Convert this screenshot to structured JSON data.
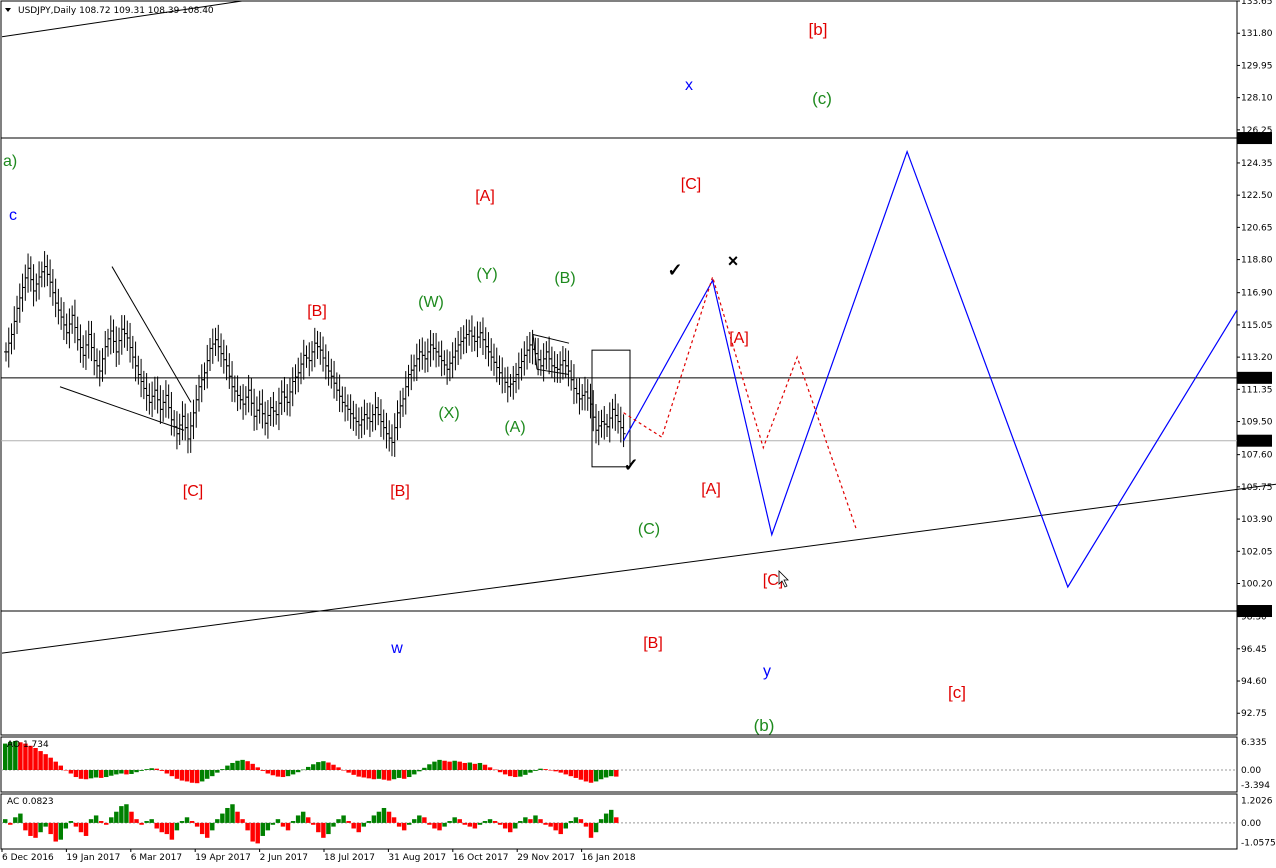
{
  "header": {
    "symbol": "USDJPY,Daily",
    "ohlc": "108.72 109.31 108.39 108.40"
  },
  "colors": {
    "red": "#e00000",
    "green": "#1e8a1e",
    "blue": "#0000ff",
    "black": "#000000",
    "osc_green": "#008000",
    "osc_red": "#ff0000"
  },
  "chart_data": {
    "type": "line",
    "title": "",
    "ylim": [
      91.5,
      133.65
    ],
    "y_ticks": [
      "133.65",
      "131.80",
      "129.95",
      "128.10",
      "126.25",
      "124.35",
      "122.50",
      "120.65",
      "118.80",
      "116.90",
      "115.05",
      "113.20",
      "111.35",
      "109.50",
      "107.60",
      "105.75",
      "103.90",
      "102.05",
      "100.20",
      "98.30",
      "96.45",
      "94.60",
      "92.75"
    ],
    "price_tags": [
      {
        "value": 125.78,
        "label": "125.78",
        "line": true
      },
      {
        "value": 112.01,
        "label": "112.01",
        "line": true
      },
      {
        "value": 108.4,
        "label": "108.40",
        "line": true
      },
      {
        "value": 98.62,
        "label": "98.62",
        "line": true
      }
    ],
    "x_labels": [
      "6 Dec 2016",
      "19 Jan 2017",
      "6 Mar 2017",
      "19 Apr 2017",
      "2 Jun 2017",
      "18 Jul 2017",
      "31 Aug 2017",
      "16 Oct 2017",
      "29 Nov 2017",
      "16 Jan 2018"
    ],
    "price_series": [
      [
        0,
        113.5
      ],
      [
        2,
        114.5
      ],
      [
        4,
        116.0
      ],
      [
        6,
        117.2
      ],
      [
        8,
        118.3
      ],
      [
        10,
        117.0
      ],
      [
        12,
        117.8
      ],
      [
        14,
        118.4
      ],
      [
        16,
        117.5
      ],
      [
        18,
        116.3
      ],
      [
        20,
        115.5
      ],
      [
        22,
        114.6
      ],
      [
        24,
        115.6
      ],
      [
        26,
        114.2
      ],
      [
        28,
        113.3
      ],
      [
        30,
        114.5
      ],
      [
        32,
        113.0
      ],
      [
        34,
        112.4
      ],
      [
        36,
        113.8
      ],
      [
        38,
        114.7
      ],
      [
        40,
        113.5
      ],
      [
        42,
        114.8
      ],
      [
        44,
        114.3
      ],
      [
        46,
        113.2
      ],
      [
        48,
        112.2
      ],
      [
        50,
        111.4
      ],
      [
        52,
        110.6
      ],
      [
        54,
        111.3
      ],
      [
        56,
        110.2
      ],
      [
        58,
        111.0
      ],
      [
        60,
        109.6
      ],
      [
        62,
        108.8
      ],
      [
        64,
        109.8
      ],
      [
        66,
        108.5
      ],
      [
        68,
        110.0
      ],
      [
        70,
        111.5
      ],
      [
        72,
        112.3
      ],
      [
        74,
        113.7
      ],
      [
        76,
        114.2
      ],
      [
        78,
        113.4
      ],
      [
        80,
        112.7
      ],
      [
        82,
        111.5
      ],
      [
        84,
        111.0
      ],
      [
        86,
        110.5
      ],
      [
        88,
        111.3
      ],
      [
        90,
        109.8
      ],
      [
        92,
        110.5
      ],
      [
        94,
        109.4
      ],
      [
        96,
        110.3
      ],
      [
        98,
        109.9
      ],
      [
        100,
        111.2
      ],
      [
        102,
        110.6
      ],
      [
        104,
        111.8
      ],
      [
        106,
        112.3
      ],
      [
        108,
        113.3
      ],
      [
        110,
        113.0
      ],
      [
        112,
        114.0
      ],
      [
        114,
        113.6
      ],
      [
        116,
        112.7
      ],
      [
        118,
        112.1
      ],
      [
        120,
        111.3
      ],
      [
        122,
        110.6
      ],
      [
        124,
        110.2
      ],
      [
        126,
        109.7
      ],
      [
        128,
        109.3
      ],
      [
        130,
        109.9
      ],
      [
        132,
        109.5
      ],
      [
        134,
        110.3
      ],
      [
        136,
        109.5
      ],
      [
        138,
        108.8
      ],
      [
        140,
        108.3
      ],
      [
        142,
        110.0
      ],
      [
        144,
        110.8
      ],
      [
        146,
        112.2
      ],
      [
        148,
        112.7
      ],
      [
        150,
        113.5
      ],
      [
        152,
        113.1
      ],
      [
        154,
        113.9
      ],
      [
        156,
        113.5
      ],
      [
        158,
        113.0
      ],
      [
        160,
        112.5
      ],
      [
        162,
        113.2
      ],
      [
        164,
        113.9
      ],
      [
        166,
        114.3
      ],
      [
        168,
        114.7
      ],
      [
        170,
        114.1
      ],
      [
        172,
        114.6
      ],
      [
        174,
        113.8
      ],
      [
        176,
        113.2
      ],
      [
        178,
        112.6
      ],
      [
        180,
        112.0
      ],
      [
        182,
        111.5
      ],
      [
        184,
        111.8
      ],
      [
        186,
        112.6
      ],
      [
        188,
        113.3
      ],
      [
        190,
        113.9
      ],
      [
        192,
        113.4
      ],
      [
        194,
        112.7
      ],
      [
        196,
        113.5
      ],
      [
        198,
        112.7
      ],
      [
        200,
        112.5
      ],
      [
        202,
        113.0
      ],
      [
        204,
        112.4
      ],
      [
        206,
        111.4
      ],
      [
        208,
        110.8
      ],
      [
        210,
        111.2
      ],
      [
        212,
        110.5
      ],
      [
        214,
        109.0
      ],
      [
        216,
        109.5
      ],
      [
        218,
        109.2
      ],
      [
        220,
        110.2
      ],
      [
        222,
        109.5
      ],
      [
        224,
        108.8
      ]
    ],
    "projection_blue": [
      [
        224,
        108.4
      ],
      [
        234,
        117.6
      ],
      [
        241,
        103.0
      ],
      [
        257,
        125.0
      ],
      [
        276,
        100.0
      ],
      [
        296,
        115.9
      ]
    ],
    "projection_red_dashed": [
      [
        224,
        110.0
      ],
      [
        228,
        108.6
      ],
      [
        234,
        117.8
      ],
      [
        240,
        108.0
      ],
      [
        244,
        113.2
      ],
      [
        251,
        103.3
      ]
    ],
    "projection_x_range": [
      224,
      296
    ],
    "annotations": {
      "red": [
        "[b]",
        "[C]",
        "[A]",
        "[B]",
        "[A]",
        "[C]",
        "[B]",
        "[A]",
        "[C]",
        "[B]",
        "[c]"
      ],
      "green": [
        "a)",
        "(c)",
        "(Y)",
        "(B)",
        "(W)",
        "(X)",
        "(A)",
        "(C)",
        "(b)"
      ],
      "blue": [
        "c",
        "x",
        "w",
        "y"
      ],
      "marks": [
        "✓",
        "✓",
        "×"
      ]
    },
    "indicators": [
      {
        "name": "AO",
        "value": "1.734",
        "y_ticks": [
          "6.335",
          "0.00",
          "-3.394"
        ],
        "ylim": [
          -5,
          7.5
        ],
        "values": [
          6.0,
          6.4,
          6.6,
          6.3,
          6.0,
          5.5,
          5.0,
          4.3,
          3.6,
          2.8,
          1.9,
          1.0,
          0.0,
          -0.8,
          -1.6,
          -2.0,
          -2.1,
          -1.9,
          -1.7,
          -1.8,
          -1.6,
          -1.3,
          -1.0,
          -0.8,
          -1.0,
          -0.9,
          -0.5,
          -0.2,
          0.2,
          0.4,
          0.3,
          -0.2,
          -0.8,
          -1.4,
          -2.0,
          -2.4,
          -2.6,
          -2.9,
          -3.0,
          -2.6,
          -2.0,
          -1.4,
          -0.6,
          0.2,
          1.0,
          1.6,
          2.1,
          2.3,
          2.0,
          1.4,
          0.6,
          -0.2,
          -0.8,
          -1.2,
          -1.5,
          -1.6,
          -1.4,
          -1.0,
          -0.5,
          0.1,
          0.7,
          1.3,
          1.8,
          2.0,
          1.7,
          1.2,
          0.6,
          0.0,
          -0.6,
          -1.1,
          -1.5,
          -1.7,
          -1.9,
          -2.1,
          -2.0,
          -2.2,
          -2.4,
          -2.1,
          -1.8,
          -2.0,
          -1.6,
          -1.0,
          -0.3,
          0.5,
          1.3,
          1.9,
          2.3,
          2.1,
          1.9,
          2.1,
          1.9,
          1.6,
          1.7,
          1.4,
          1.6,
          1.2,
          0.6,
          0.1,
          -0.5,
          -1.0,
          -1.4,
          -1.6,
          -1.5,
          -1.1,
          -0.6,
          -0.2,
          0.3,
          0.2,
          0.0,
          -0.3,
          -0.6,
          -1.0,
          -1.4,
          -1.8,
          -2.2,
          -2.6,
          -2.9,
          -2.6,
          -2.1,
          -1.7,
          -1.4,
          -1.5
        ]
      },
      {
        "name": "AC",
        "value": "0.0823",
        "y_ticks": [
          "1.2026",
          "0.00",
          "-1.0575"
        ],
        "ylim": [
          -1.4,
          1.55
        ],
        "values": [
          0.2,
          -0.1,
          0.3,
          0.5,
          -0.4,
          -0.7,
          -0.8,
          -0.5,
          -0.2,
          -0.6,
          -1.0,
          -0.9,
          -0.3,
          0.1,
          -0.2,
          -0.5,
          -0.7,
          0.2,
          0.4,
          0.1,
          -0.1,
          0.3,
          0.6,
          0.9,
          1.0,
          0.6,
          0.2,
          -0.1,
          0.1,
          0.2,
          -0.3,
          -0.5,
          -0.6,
          -0.9,
          -0.4,
          0.1,
          0.3,
          0.1,
          -0.2,
          -0.6,
          -0.8,
          -0.4,
          0.2,
          0.5,
          0.8,
          1.0,
          0.6,
          0.2,
          -0.4,
          -1.0,
          -1.1,
          -0.7,
          -0.4,
          -0.1,
          0.2,
          -0.2,
          -0.4,
          0.1,
          0.4,
          0.6,
          0.3,
          -0.1,
          -0.5,
          -0.8,
          -0.6,
          -0.2,
          0.2,
          0.4,
          0.1,
          -0.3,
          -0.5,
          -0.2,
          0.1,
          0.4,
          0.6,
          0.8,
          0.6,
          0.3,
          -0.2,
          -0.4,
          -0.1,
          0.2,
          0.4,
          0.3,
          -0.1,
          -0.3,
          -0.4,
          -0.2,
          0.1,
          0.3,
          0.2,
          -0.1,
          -0.2,
          -0.3,
          -0.1,
          0.1,
          0.2,
          0.1,
          -0.1,
          -0.3,
          -0.5,
          -0.3,
          0.1,
          0.3,
          0.2,
          0.4,
          0.2,
          -0.1,
          -0.2,
          -0.4,
          -0.6,
          -0.3,
          0.1,
          0.3,
          0.2,
          -0.2,
          -0.8,
          -0.5,
          0.2,
          0.5,
          0.7,
          0.3
        ]
      }
    ]
  }
}
